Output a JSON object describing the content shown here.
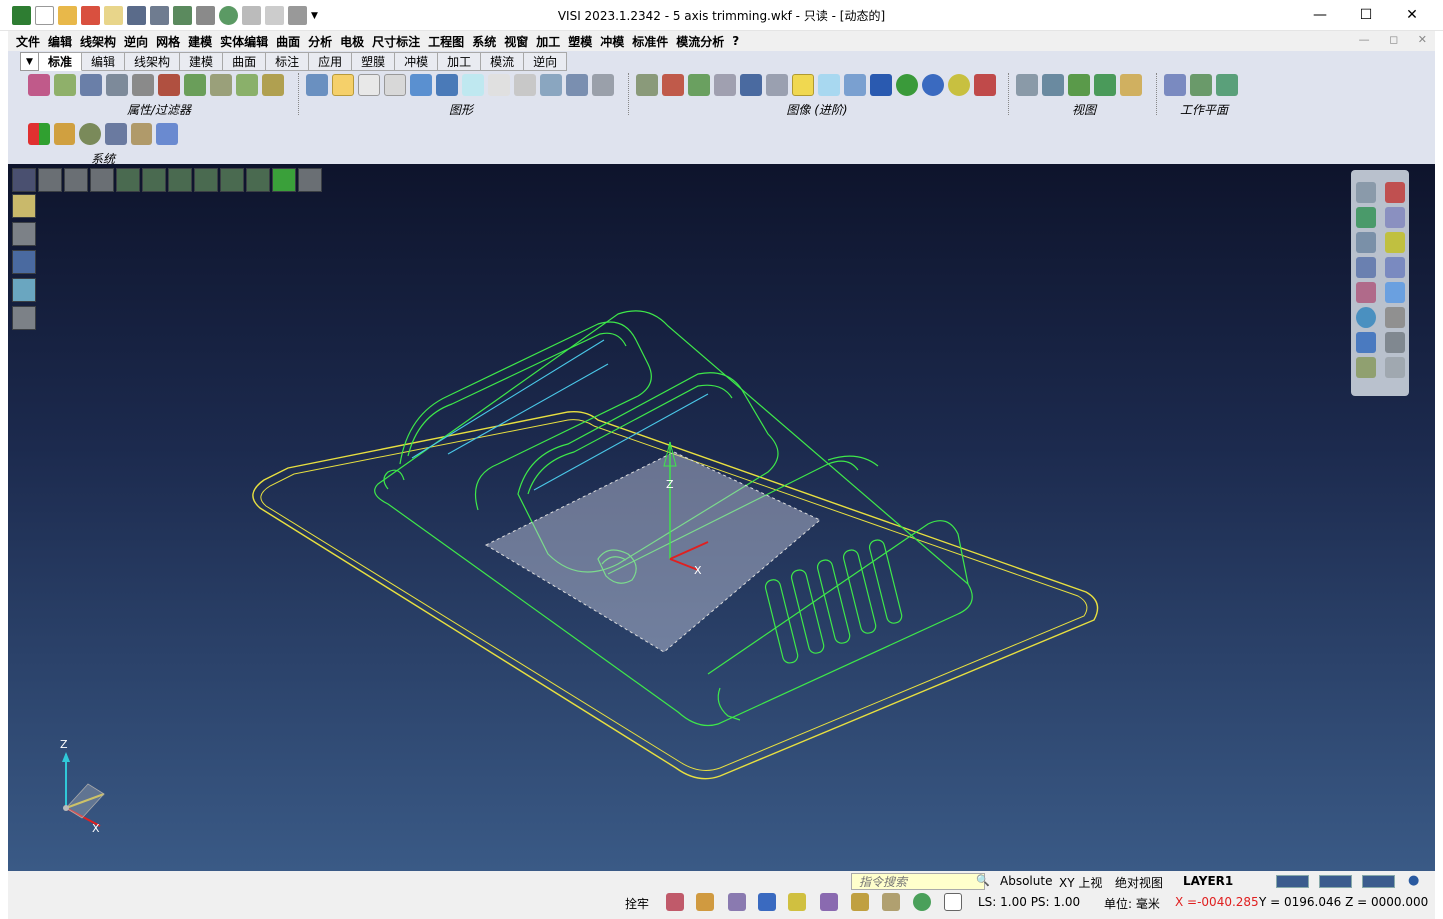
{
  "window": {
    "title": "VISI 2023.1.2342 - 5 axis trimming.wkf - 只读 - [动态的]",
    "controls": {
      "minimize": "—",
      "maximize": "☐",
      "close": "✕"
    }
  },
  "menu": [
    "文件",
    "编辑",
    "线架构",
    "逆向",
    "网格",
    "建模",
    "实体编辑",
    "曲面",
    "分析",
    "电极",
    "尺寸标注",
    "工程图",
    "系统",
    "视窗",
    "加工",
    "塑模",
    "冲模",
    "标准件",
    "模流分析",
    "?"
  ],
  "ribbon": {
    "tabs": [
      "标准",
      "编辑",
      "线架构",
      "建模",
      "曲面",
      "标注",
      "应用",
      "塑膜",
      "冲模",
      "加工",
      "模流",
      "逆向"
    ],
    "active_tab": "标准",
    "groups": {
      "attrs": "属性/过滤器",
      "shapes": "图形",
      "image": "图像 (进阶)",
      "view": "视图",
      "workplane": "工作平面",
      "system": "系统"
    }
  },
  "triad": {
    "z": "Z",
    "x": "X"
  },
  "status": {
    "search_placeholder": "指令搜索",
    "mode": "Absolute",
    "view": "XY 上视",
    "abs_view": "绝对视图",
    "layer": "LAYER1",
    "snap": "拴牢",
    "ls_ps": "LS: 1.00 PS: 1.00",
    "unit": "单位: 毫米",
    "x": "X =-0040.285",
    "yz": "Y = 0196.046 Z = 0000.000"
  }
}
